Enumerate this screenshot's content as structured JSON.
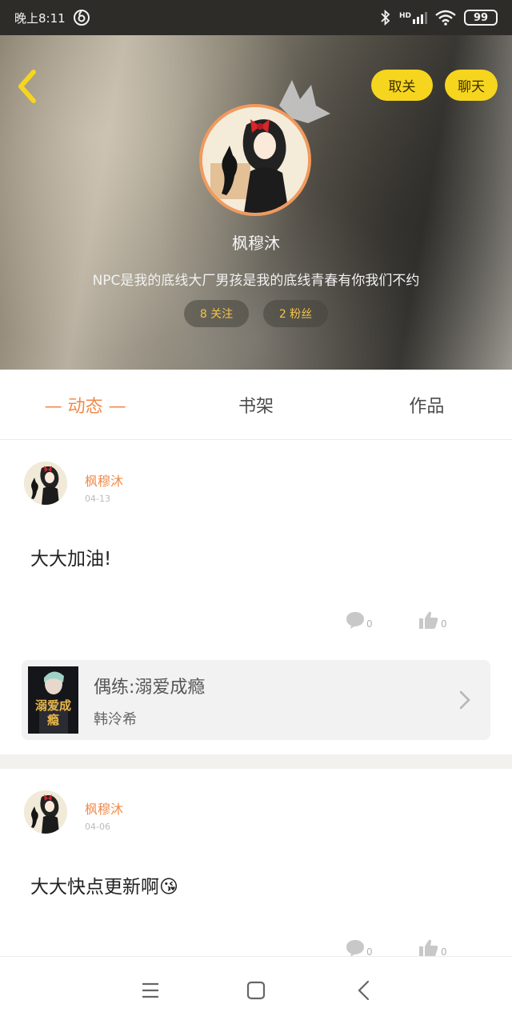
{
  "status_bar": {
    "time": "晚上8:11",
    "network": "HD",
    "battery": "99"
  },
  "header": {
    "unfollow_label": "取关",
    "chat_label": "聊天",
    "nickname": "枫穆沐",
    "bio": "NPC是我的底线大厂男孩是我的底线青春有你我们不约",
    "follows": "8 关注",
    "fans": "2 粉丝"
  },
  "tabs": [
    {
      "label": "— 动态 —",
      "active": true
    },
    {
      "label": "书架",
      "active": false
    },
    {
      "label": "作品",
      "active": false
    }
  ],
  "posts": [
    {
      "author": "枫穆沐",
      "date": "04-13",
      "text": "大大加油!",
      "comments": "0",
      "likes": "0",
      "book": {
        "title": "偶练:溺爱成瘾",
        "author": "韩泠希",
        "cover_text": "溺爱成瘾"
      }
    },
    {
      "author": "枫穆沐",
      "date": "04-06",
      "text": "大大快点更新啊😘",
      "comments": "0",
      "likes": "0"
    }
  ],
  "colors": {
    "accent": "#f08b4b",
    "button_yellow": "#f6d51f",
    "fan_text": "#f2c44d"
  }
}
